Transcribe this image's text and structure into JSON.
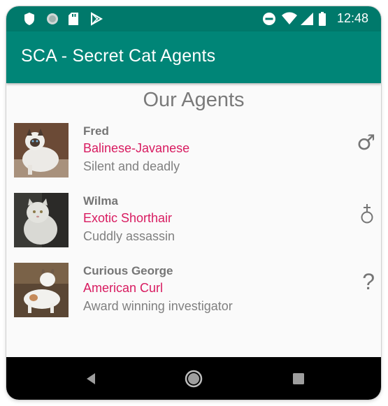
{
  "status_bar": {
    "time": "12:48",
    "left_icons": [
      "shield-icon",
      "circle-app-icon",
      "sd-card-icon",
      "play-store-icon"
    ],
    "right_icons": [
      "do-not-disturb-icon",
      "wifi-icon",
      "signal-icon",
      "battery-icon"
    ]
  },
  "app_bar": {
    "title": "SCA - Secret Cat Agents"
  },
  "main": {
    "heading": "Our Agents",
    "agents": [
      {
        "name": "Fred",
        "breed": "Balinese-Javanese",
        "description": "Silent and deadly",
        "gender_symbol": "♂",
        "gender_icon": "male-icon"
      },
      {
        "name": "Wilma",
        "breed": "Exotic Shorthair",
        "description": "Cuddly assassin",
        "gender_symbol": "⚲",
        "gender_icon": "female-icon"
      },
      {
        "name": "Curious George",
        "breed": "American Curl",
        "description": "Award winning investigator",
        "gender_symbol": "?",
        "gender_icon": "unknown-gender-icon"
      }
    ]
  },
  "nav_bar": {
    "buttons": [
      "back-icon",
      "home-icon",
      "recents-icon"
    ]
  },
  "colors": {
    "status_bar": "#00796b",
    "app_bar": "#008577",
    "accent": "#d81b60",
    "text_gray": "#757575"
  }
}
